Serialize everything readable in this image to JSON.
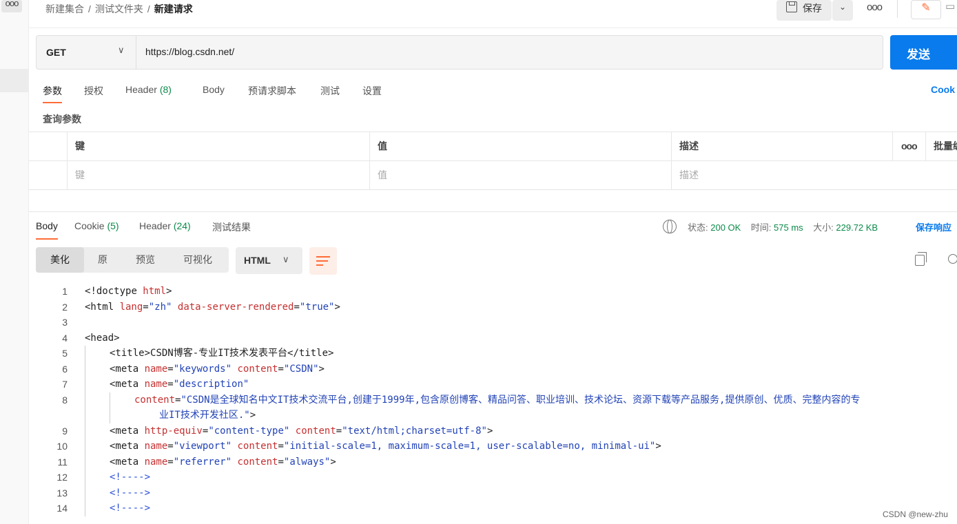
{
  "sidebar": {
    "more_label": "ooo"
  },
  "breadcrumb": {
    "collection": "新建集合",
    "folder": "测试文件夹",
    "current": "新建请求",
    "separator": "/"
  },
  "toolbar": {
    "save_label": "保存",
    "more_label": "ooo"
  },
  "request": {
    "method": "GET",
    "url": "https://blog.csdn.net/",
    "send_label": "发送"
  },
  "request_tabs": [
    {
      "label": "参数",
      "count": ""
    },
    {
      "label": "授权",
      "count": ""
    },
    {
      "label": "Header",
      "count": "(8)"
    },
    {
      "label": "Body",
      "count": ""
    },
    {
      "label": "预请求脚本",
      "count": ""
    },
    {
      "label": "测试",
      "count": ""
    },
    {
      "label": "设置",
      "count": ""
    }
  ],
  "cookies_link": "Cook",
  "params": {
    "title": "查询参数",
    "headers": {
      "key": "键",
      "value": "值",
      "description": "描述",
      "more": "ooo",
      "bulk": "批量编"
    },
    "placeholder": {
      "key": "键",
      "value": "值",
      "description": "描述"
    }
  },
  "response_tabs": [
    {
      "label": "Body",
      "count": ""
    },
    {
      "label": "Cookie",
      "count": "(5)"
    },
    {
      "label": "Header",
      "count": "(24)"
    },
    {
      "label": "测试结果",
      "count": ""
    }
  ],
  "response_status": {
    "status_label": "状态:",
    "status_value": "200 OK",
    "time_label": "时间:",
    "time_value": "575 ms",
    "size_label": "大小:",
    "size_value": "229.72 KB",
    "save_response": "保存响应"
  },
  "view_modes": [
    "美化",
    "原",
    "预览",
    "可视化"
  ],
  "language": "HTML",
  "code_lines": [
    {
      "n": "1",
      "tokens": [
        [
          "punct",
          "<"
        ],
        [
          "tg",
          "!doctype "
        ],
        [
          "at",
          "html"
        ],
        [
          "punct",
          ">"
        ]
      ]
    },
    {
      "n": "2",
      "tokens": [
        [
          "tg",
          "<html "
        ],
        [
          "at",
          "lang"
        ],
        [
          "punct",
          "="
        ],
        [
          "vl",
          "\"zh\""
        ],
        [
          "punct",
          " "
        ],
        [
          "at",
          "data-server-rendered"
        ],
        [
          "punct",
          "="
        ],
        [
          "vl",
          "\"true\""
        ],
        [
          "tg",
          ">"
        ]
      ]
    },
    {
      "n": "3",
      "tokens": []
    },
    {
      "n": "4",
      "tokens": [
        [
          "tg",
          "<head>"
        ]
      ]
    },
    {
      "n": "5",
      "tokens": [
        [
          "tg",
          "<title>"
        ],
        [
          "tg",
          "CSDN博客-专业IT技术发表平台"
        ],
        [
          "tg",
          "</title>"
        ]
      ]
    },
    {
      "n": "6",
      "tokens": [
        [
          "tg",
          "<meta "
        ],
        [
          "at",
          "name"
        ],
        [
          "punct",
          "="
        ],
        [
          "vl",
          "\"keywords\""
        ],
        [
          "punct",
          " "
        ],
        [
          "at",
          "content"
        ],
        [
          "punct",
          "="
        ],
        [
          "vl",
          "\"CSDN\""
        ],
        [
          "tg",
          ">"
        ]
      ]
    },
    {
      "n": "7",
      "tokens": [
        [
          "tg",
          "<meta "
        ],
        [
          "at",
          "name"
        ],
        [
          "punct",
          "="
        ],
        [
          "vl",
          "\"description\""
        ]
      ]
    },
    {
      "n": "8",
      "tokens": [
        [
          "at",
          "content"
        ],
        [
          "punct",
          "="
        ],
        [
          "vl",
          "\"CSDN是全球知名中文IT技术交流平台,创建于1999年,包含原创博客、精品问答、职业培训、技术论坛、资源下载等产品服务,提供原创、优质、完整内容的专"
        ]
      ]
    },
    {
      "n": "",
      "tokens": [
        [
          "vl",
          "业IT技术开发社区.\""
        ],
        [
          "tg",
          ">"
        ]
      ]
    },
    {
      "n": "9",
      "tokens": [
        [
          "tg",
          "<meta "
        ],
        [
          "at",
          "http-equiv"
        ],
        [
          "punct",
          "="
        ],
        [
          "vl",
          "\"content-type\""
        ],
        [
          "punct",
          " "
        ],
        [
          "at",
          "content"
        ],
        [
          "punct",
          "="
        ],
        [
          "vl",
          "\"text/html;charset=utf-8\""
        ],
        [
          "tg",
          ">"
        ]
      ]
    },
    {
      "n": "10",
      "tokens": [
        [
          "tg",
          "<meta "
        ],
        [
          "at",
          "name"
        ],
        [
          "punct",
          "="
        ],
        [
          "vl",
          "\"viewport\""
        ],
        [
          "punct",
          " "
        ],
        [
          "at",
          "content"
        ],
        [
          "punct",
          "="
        ],
        [
          "vl",
          "\"initial-scale=1, maximum-scale=1, user-scalable=no, minimal-ui\""
        ],
        [
          "tg",
          ">"
        ]
      ]
    },
    {
      "n": "11",
      "tokens": [
        [
          "tg",
          "<meta "
        ],
        [
          "at",
          "name"
        ],
        [
          "punct",
          "="
        ],
        [
          "vl",
          "\"referrer\""
        ],
        [
          "punct",
          " "
        ],
        [
          "at",
          "content"
        ],
        [
          "punct",
          "="
        ],
        [
          "vl",
          "\"always\""
        ],
        [
          "tg",
          ">"
        ]
      ]
    },
    {
      "n": "12",
      "tokens": [
        [
          "cm",
          "<!---->"
        ]
      ]
    },
    {
      "n": "13",
      "tokens": [
        [
          "cm",
          "<!---->"
        ]
      ]
    },
    {
      "n": "14",
      "tokens": [
        [
          "cm",
          "<!---->"
        ]
      ]
    }
  ],
  "watermark": "CSDN @new-zhu",
  "colors": {
    "accent": "#ff6c37",
    "primary": "#097bed",
    "success": "#0b8a49"
  }
}
